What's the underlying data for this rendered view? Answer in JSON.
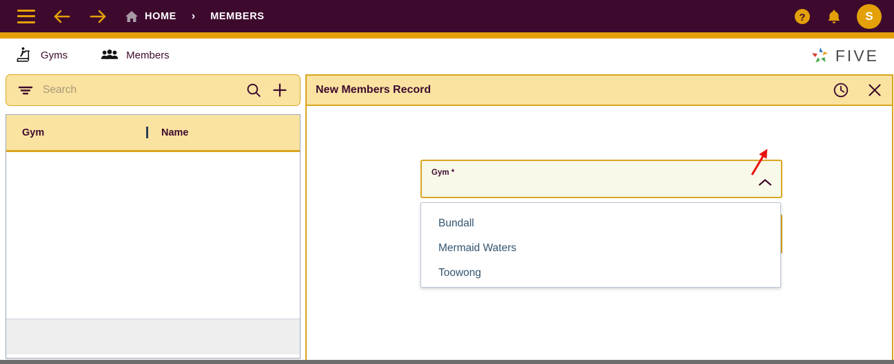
{
  "topbar": {
    "menu_icon": "hamburger-icon",
    "back_icon": "arrow-left-icon",
    "forward_icon": "arrow-right-icon",
    "home_icon": "home-icon",
    "home_label": "HOME",
    "separator": "›",
    "current_crumb": "MEMBERS",
    "help_icon": "help-circle-icon",
    "bell_icon": "bell-icon",
    "avatar_initial": "S",
    "bg_color": "#3D0A2E",
    "accent_color": "#E3A008"
  },
  "tabs": [
    {
      "label": "Gyms",
      "icon": "treadmill-icon"
    },
    {
      "label": "Members",
      "icon": "people-icon"
    }
  ],
  "brand": {
    "name": "FIVE",
    "logo_icon": "five-pinwheel-logo",
    "colors": [
      "#3C7DC4",
      "#E8A020",
      "#4CA84C",
      "#D83A2C"
    ]
  },
  "left_panel": {
    "search": {
      "filter_icon": "filter-icon",
      "placeholder": "Search",
      "value": "",
      "search_icon": "search-icon",
      "add_icon": "plus-icon"
    },
    "table": {
      "columns": [
        "Gym",
        "Name"
      ],
      "rows": []
    }
  },
  "right_panel": {
    "title": "New Members Record",
    "history_icon": "clock-history-icon",
    "close_icon": "close-icon",
    "gym_field": {
      "label": "Gym *",
      "value": "",
      "chevron_icon": "chevron-up-icon",
      "expanded": true,
      "options": [
        "Bundall",
        "Mermaid Waters",
        "Toowong"
      ]
    }
  },
  "annotation": {
    "arrow_icon": "red-arrow-icon",
    "color": "#E81010"
  }
}
